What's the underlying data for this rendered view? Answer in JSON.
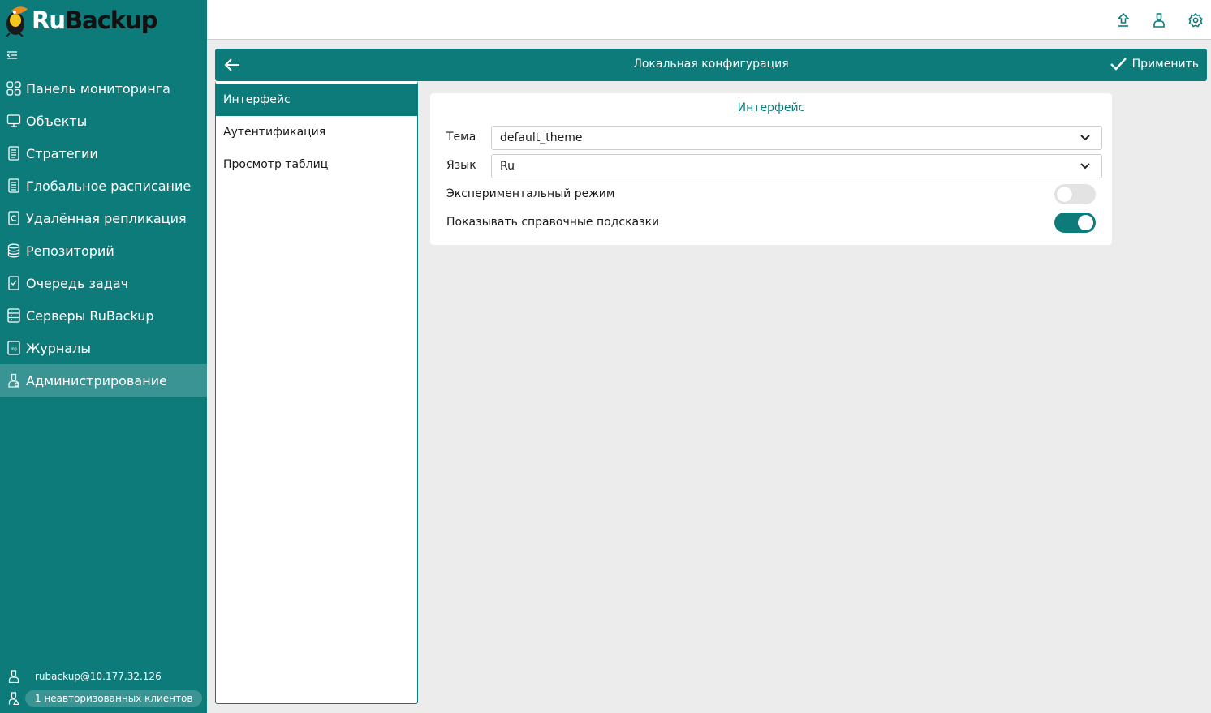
{
  "brand": {
    "part1": "Ru",
    "part2": "Backup"
  },
  "sidebar": {
    "items": [
      {
        "label": "Панель мониторинга",
        "icon": "dashboard-icon"
      },
      {
        "label": "Объекты",
        "icon": "monitor-icon"
      },
      {
        "label": "Стратегии",
        "icon": "document-icon"
      },
      {
        "label": "Глобальное расписание",
        "icon": "schedule-icon"
      },
      {
        "label": "Удалённая репликация",
        "icon": "replication-icon"
      },
      {
        "label": "Репозиторий",
        "icon": "database-icon"
      },
      {
        "label": "Очередь задач",
        "icon": "task-queue-icon"
      },
      {
        "label": "Серверы RuBackup",
        "icon": "server-icon"
      },
      {
        "label": "Журналы",
        "icon": "log-icon"
      },
      {
        "label": "Администрирование",
        "icon": "admin-icon",
        "active": true
      }
    ],
    "user": "rubackup@10.177.32.126",
    "clients_badge": "1 неавторизованных клиентов"
  },
  "topbar": {
    "icons": [
      "upload-icon",
      "user-icon",
      "settings-icon"
    ]
  },
  "header": {
    "title": "Локальная конфигурация",
    "apply_label": "Применить"
  },
  "settings_nav": {
    "items": [
      "Интерфейс",
      "Аутентификация",
      "Просмотр таблиц"
    ],
    "active": "Интерфейс"
  },
  "card": {
    "title": "Интерфейс",
    "theme_label": "Тема",
    "theme_value": "default_theme",
    "language_label": "Язык",
    "language_value": "Ru",
    "experimental_label": "Экспериментальный режим",
    "experimental_on": false,
    "hints_label": "Показывать справочные подсказки",
    "hints_on": true
  },
  "colors": {
    "primary": "#0e7b7b",
    "active_nav": "#3a9494",
    "background": "#ececec"
  }
}
